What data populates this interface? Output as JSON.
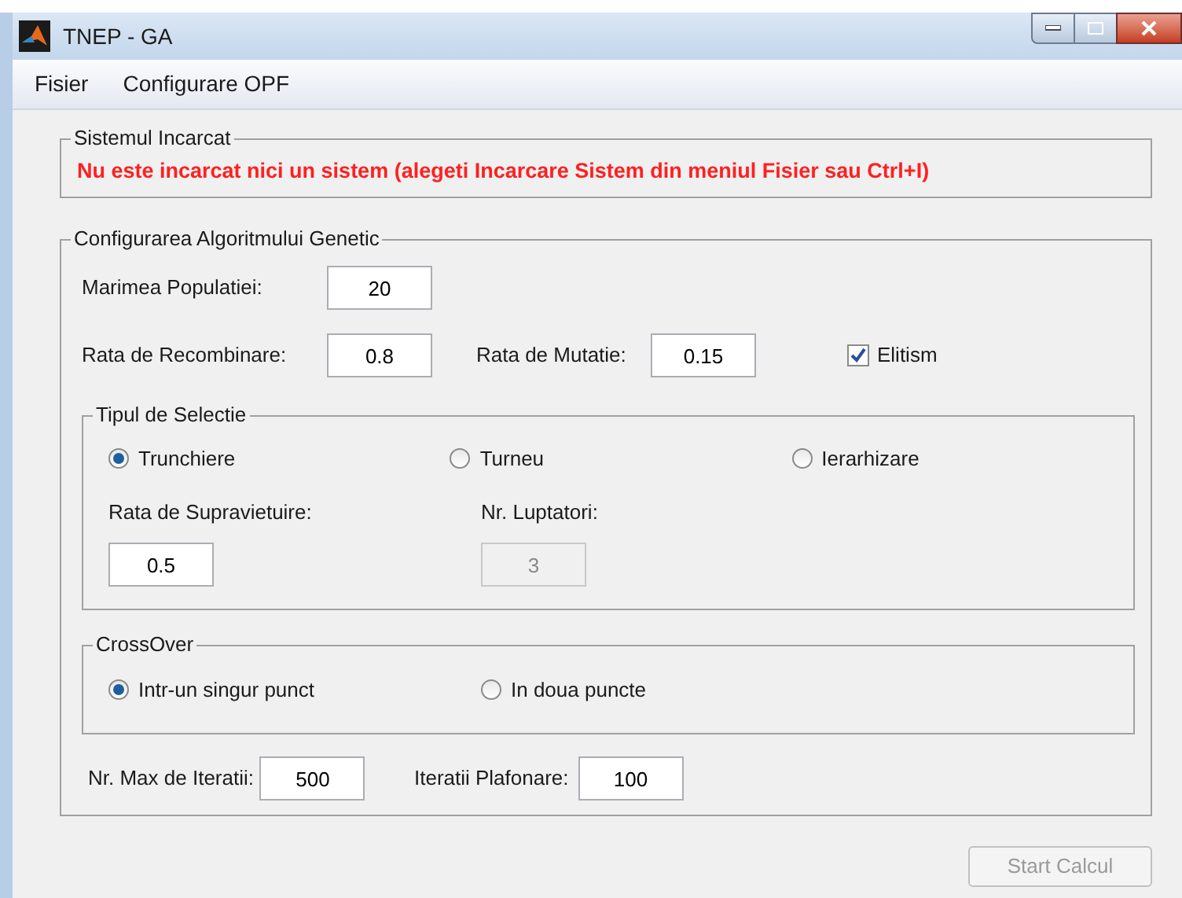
{
  "window": {
    "title": "TNEP - GA"
  },
  "menu": [
    {
      "label": "Fisier"
    },
    {
      "label": "Configurare OPF"
    }
  ],
  "system_group": {
    "title": "Sistemul Incarcat",
    "message": "Nu este incarcat nici un sistem (alegeti Incarcare Sistem din meniul Fisier sau Ctrl+I)"
  },
  "ga_group": {
    "title": "Configurarea Algoritmului Genetic",
    "population": {
      "label": "Marimea Populatiei:",
      "value": "20"
    },
    "recombination": {
      "label": "Rata de Recombinare:",
      "value": "0.8"
    },
    "mutation": {
      "label": "Rata de Mutatie:",
      "value": "0.15"
    },
    "elitism": {
      "label": "Elitism",
      "checked": true
    },
    "selection": {
      "title": "Tipul de Selectie",
      "options": [
        {
          "label": "Trunchiere",
          "selected": true
        },
        {
          "label": "Turneu",
          "selected": false
        },
        {
          "label": "Ierarhizare",
          "selected": false
        }
      ],
      "survival": {
        "label": "Rata de Supravietuire:",
        "value": "0.5",
        "disabled": false
      },
      "fighters": {
        "label": "Nr. Luptatori:",
        "value": "3",
        "disabled": true
      }
    },
    "crossover": {
      "title": "CrossOver",
      "options": [
        {
          "label": "Intr-un singur punct",
          "selected": true
        },
        {
          "label": "In doua puncte",
          "selected": false
        }
      ]
    },
    "max_iterations": {
      "label": "Nr. Max de Iteratii:",
      "value": "500"
    },
    "plateau_iterations": {
      "label": "Iteratii Plafonare:",
      "value": "100"
    }
  },
  "start_button": {
    "label": "Start Calcul",
    "disabled": true
  }
}
